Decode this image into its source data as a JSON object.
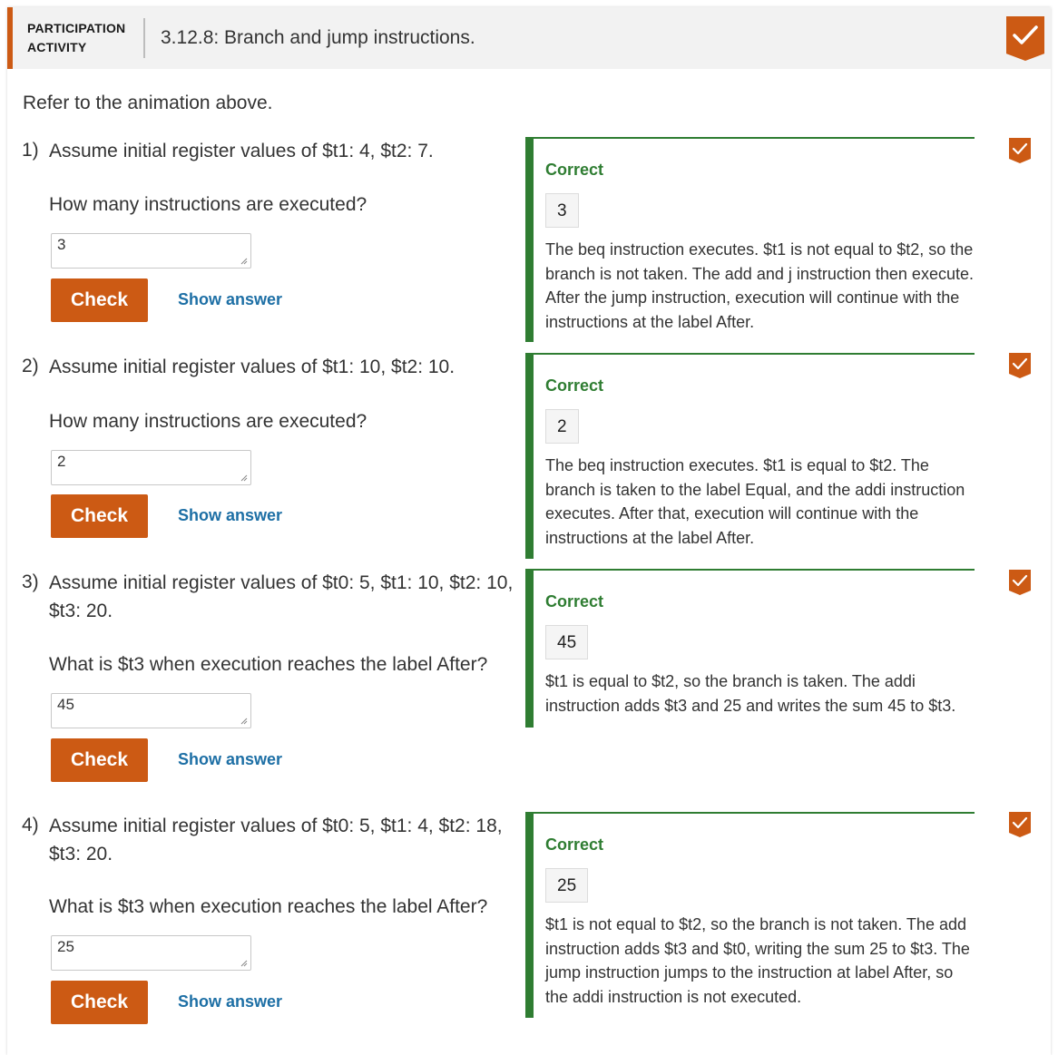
{
  "header": {
    "type_label": "PARTICIPATION ACTIVITY",
    "title": "3.12.8: Branch and jump instructions.",
    "badge_icon": "checkmark-icon",
    "accent_color": "#cc5a14"
  },
  "intro": "Refer to the animation above.",
  "buttons": {
    "check_label": "Check",
    "show_answer_label": "Show answer"
  },
  "feedback_color": "#2f7d32",
  "questions": [
    {
      "number": "1)",
      "text": "Assume initial register values of $t1: 4, $t2: 7.",
      "prompt": "How many instructions are executed?",
      "input_value": "3",
      "feedback_status": "Correct",
      "correct_answer": "3",
      "explanation": "The beq instruction executes. $t1 is not equal to $t2, so the branch is not taken. The add and j instruction then execute. After the jump instruction, execution will continue with the instructions at the label After."
    },
    {
      "number": "2)",
      "text": "Assume initial register values of $t1: 10, $t2: 10.",
      "prompt": "How many instructions are executed?",
      "input_value": "2",
      "feedback_status": "Correct",
      "correct_answer": "2",
      "explanation": "The beq instruction executes. $t1 is equal to $t2. The branch is taken to the label Equal, and the addi instruction executes. After that, execution will continue with the instructions at the label After."
    },
    {
      "number": "3)",
      "text": "Assume initial register values of $t0: 5, $t1: 10, $t2: 10, $t3: 20.",
      "prompt": "What is $t3 when execution reaches the label After?",
      "input_value": "45",
      "feedback_status": "Correct",
      "correct_answer": "45",
      "explanation": "$t1 is equal to $t2, so the branch is taken. The addi instruction adds $t3 and 25 and writes the sum 45 to $t3."
    },
    {
      "number": "4)",
      "text": "Assume initial register values of $t0: 5, $t1: 4, $t2: 18, $t3: 20.",
      "prompt": "What is $t3 when execution reaches the label After?",
      "input_value": "25",
      "feedback_status": "Correct",
      "correct_answer": "25",
      "explanation": "$t1 is not equal to $t2, so the branch is not taken. The add instruction adds $t3 and $t0, writing the sum 25 to $t3. The jump instruction jumps to the instruction at label After, so the addi instruction is not executed."
    }
  ]
}
